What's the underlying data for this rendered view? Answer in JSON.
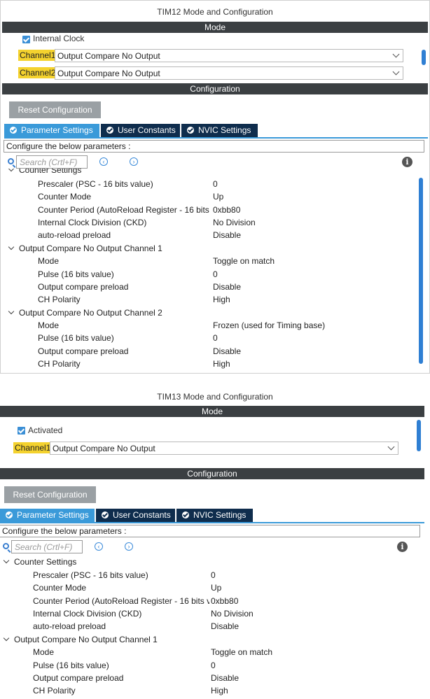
{
  "panel1": {
    "title": "TIM12 Mode and Configuration",
    "mode_header": "Mode",
    "internal_clock_label": "Internal Clock",
    "channel1_label": "Channel1",
    "channel1_value": "Output Compare No Output",
    "channel2_label": "Channel2",
    "channel2_value": "Output Compare No Output",
    "config_header": "Configuration",
    "reset_button": "Reset Configuration",
    "tabs": [
      "Parameter Settings",
      "User Constants",
      "NVIC Settings"
    ],
    "configure_text": "Configure the below parameters :",
    "search_placeholder": "Search (Crtl+F)",
    "groups": [
      {
        "name": "Counter Settings",
        "params": [
          {
            "name": "Prescaler (PSC - 16 bits value)",
            "value": "0"
          },
          {
            "name": "Counter Mode",
            "value": "Up"
          },
          {
            "name": "Counter Period (AutoReload Register - 16 bits v...",
            "value": "0xbb80"
          },
          {
            "name": "Internal Clock Division (CKD)",
            "value": "No Division"
          },
          {
            "name": "auto-reload preload",
            "value": "Disable"
          }
        ]
      },
      {
        "name": "Output Compare No Output Channel 1",
        "params": [
          {
            "name": "Mode",
            "value": "Toggle on match"
          },
          {
            "name": "Pulse (16 bits value)",
            "value": "0"
          },
          {
            "name": "Output compare preload",
            "value": "Disable"
          },
          {
            "name": "CH Polarity",
            "value": "High"
          }
        ]
      },
      {
        "name": "Output Compare No Output Channel 2",
        "params": [
          {
            "name": "Mode",
            "value": "Frozen (used for Timing base)"
          },
          {
            "name": "Pulse (16 bits value)",
            "value": "0"
          },
          {
            "name": "Output compare preload",
            "value": "Disable"
          },
          {
            "name": "CH Polarity",
            "value": "High"
          }
        ]
      }
    ]
  },
  "panel2": {
    "title": "TIM13 Mode and Configuration",
    "mode_header": "Mode",
    "activated_label": "Activated",
    "channel1_label": "Channel1",
    "channel1_value": "Output Compare No Output",
    "config_header": "Configuration",
    "reset_button": "Reset Configuration",
    "tabs": [
      "Parameter Settings",
      "User Constants",
      "NVIC Settings"
    ],
    "configure_text": "Configure the below parameters :",
    "search_placeholder": "Search (Crtl+F)",
    "groups": [
      {
        "name": "Counter Settings",
        "params": [
          {
            "name": "Prescaler (PSC - 16 bits value)",
            "value": "0"
          },
          {
            "name": "Counter Mode",
            "value": "Up"
          },
          {
            "name": "Counter Period (AutoReload Register - 16 bits va...",
            "value": "0xbb80"
          },
          {
            "name": "Internal Clock Division (CKD)",
            "value": "No Division"
          },
          {
            "name": "auto-reload preload",
            "value": "Disable"
          }
        ]
      },
      {
        "name": "Output Compare No Output Channel 1",
        "params": [
          {
            "name": "Mode",
            "value": "Toggle on match"
          },
          {
            "name": "Pulse (16 bits value)",
            "value": "0"
          },
          {
            "name": "Output compare preload",
            "value": "Disable"
          },
          {
            "name": "CH Polarity",
            "value": "High"
          }
        ]
      }
    ]
  },
  "colors": {
    "header_bar": "#3b3f42",
    "tab_active": "#3a9ad9",
    "tab_inactive": "#0f2d4d",
    "channel_highlight": "#f4d22e",
    "reset_button": "#9aa0a4",
    "scrollbar": "#2f7fd3"
  },
  "icons": [
    "checkbox-checked-icon",
    "chevron-down-icon",
    "search-icon",
    "prev-icon",
    "next-icon",
    "info-icon",
    "tab-check-icon"
  ]
}
